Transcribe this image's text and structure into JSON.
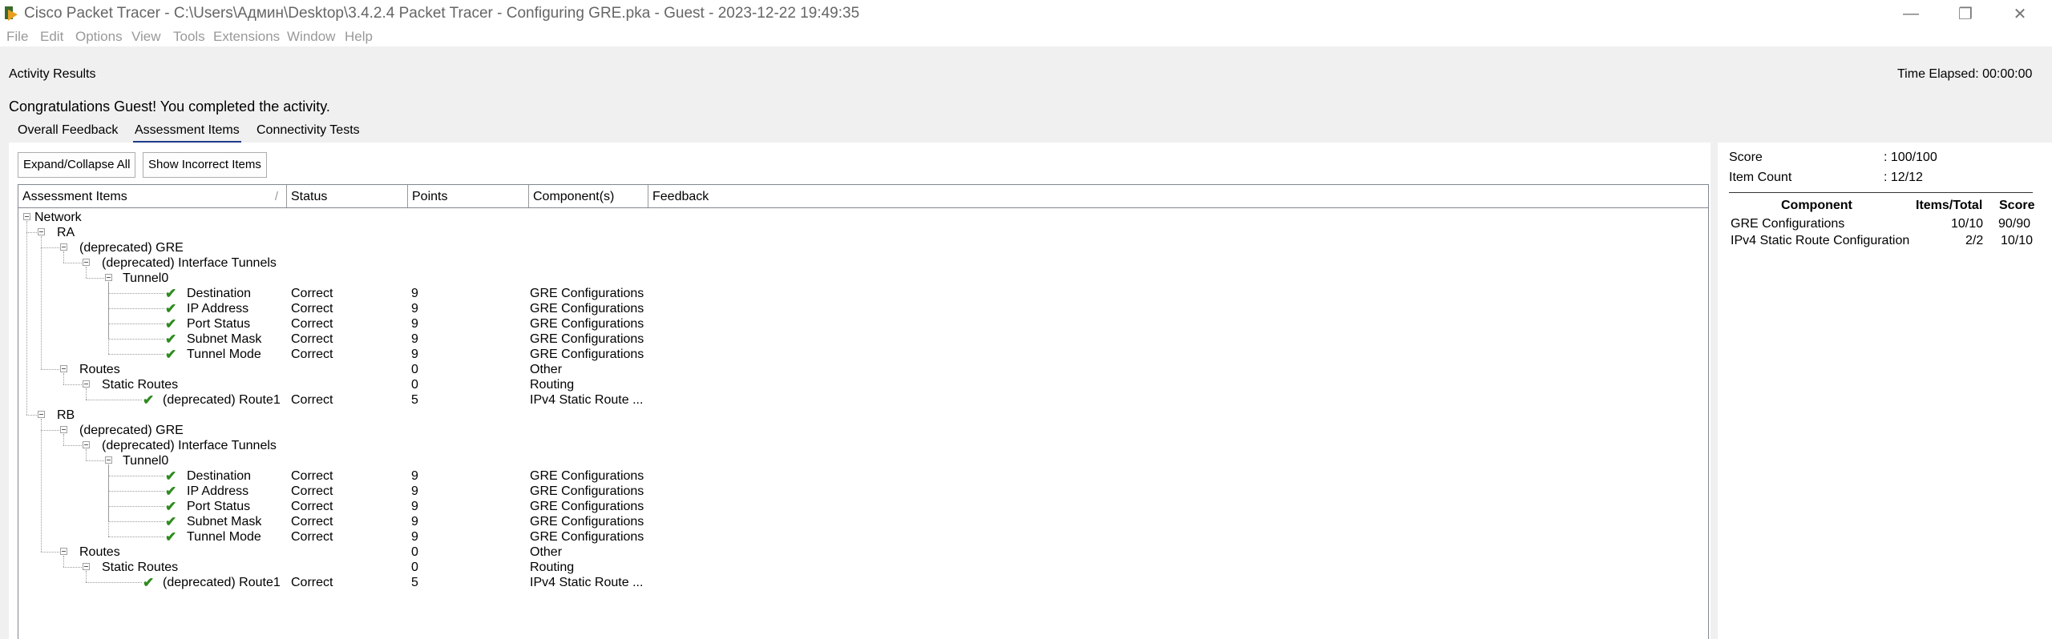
{
  "window": {
    "title": "Cisco Packet Tracer - C:\\Users\\Админ\\Desktop\\3.4.2.4 Packet Tracer - Configuring GRE.pka - Guest - 2023-12-22 19:49:35",
    "minimize": "—",
    "restore": "❐",
    "close": "✕"
  },
  "menu": [
    "File",
    "Edit",
    "Options",
    "View",
    "Tools",
    "Extensions",
    "Window",
    "Help"
  ],
  "activity": {
    "title": "Activity Results",
    "time_elapsed": "Time Elapsed: 00:00:00",
    "congrats": "Congratulations Guest! You completed the activity."
  },
  "tabs": [
    "Overall Feedback",
    "Assessment Items",
    "Connectivity Tests"
  ],
  "buttons": {
    "expand": "Expand/Collapse All",
    "show_incorrect": "Show Incorrect Items"
  },
  "columns": [
    "Assessment Items",
    "Status",
    "Points",
    "Component(s)",
    "Feedback"
  ],
  "sort_glyph": "/",
  "tree": [
    {
      "label": "Network",
      "level": 0,
      "toggle": true
    },
    {
      "label": "RA",
      "level": 1,
      "toggle": true
    },
    {
      "label": "(deprecated) GRE",
      "level": 2,
      "toggle": true
    },
    {
      "label": "(deprecated) Interface Tunnels",
      "level": 3,
      "toggle": true
    },
    {
      "label": "Tunnel0",
      "level": 4,
      "toggle": true
    },
    {
      "label": "Destination",
      "level": 5,
      "check": true,
      "status": "Correct",
      "points": "9",
      "component": "GRE Configurations"
    },
    {
      "label": "IP Address",
      "level": 5,
      "check": true,
      "status": "Correct",
      "points": "9",
      "component": "GRE Configurations"
    },
    {
      "label": "Port Status",
      "level": 5,
      "check": true,
      "status": "Correct",
      "points": "9",
      "component": "GRE Configurations"
    },
    {
      "label": "Subnet Mask",
      "level": 5,
      "check": true,
      "status": "Correct",
      "points": "9",
      "component": "GRE Configurations"
    },
    {
      "label": "Tunnel Mode",
      "level": 5,
      "check": true,
      "status": "Correct",
      "points": "9",
      "component": "GRE Configurations"
    },
    {
      "label": "Routes",
      "level": 2,
      "toggle": true,
      "points": "0",
      "component": "Other"
    },
    {
      "label": "Static Routes",
      "level": 3,
      "toggle": true,
      "points": "0",
      "component": "Routing"
    },
    {
      "label": "(deprecated) Route1",
      "level": 4,
      "check": true,
      "status": "Correct",
      "points": "5",
      "component": "IPv4 Static Route ..."
    },
    {
      "label": "RB",
      "level": 1,
      "toggle": true
    },
    {
      "label": "(deprecated) GRE",
      "level": 2,
      "toggle": true
    },
    {
      "label": "(deprecated) Interface Tunnels",
      "level": 3,
      "toggle": true
    },
    {
      "label": "Tunnel0",
      "level": 4,
      "toggle": true
    },
    {
      "label": "Destination",
      "level": 5,
      "check": true,
      "status": "Correct",
      "points": "9",
      "component": "GRE Configurations"
    },
    {
      "label": "IP Address",
      "level": 5,
      "check": true,
      "status": "Correct",
      "points": "9",
      "component": "GRE Configurations"
    },
    {
      "label": "Port Status",
      "level": 5,
      "check": true,
      "status": "Correct",
      "points": "9",
      "component": "GRE Configurations"
    },
    {
      "label": "Subnet Mask",
      "level": 5,
      "check": true,
      "status": "Correct",
      "points": "9",
      "component": "GRE Configurations"
    },
    {
      "label": "Tunnel Mode",
      "level": 5,
      "check": true,
      "status": "Correct",
      "points": "9",
      "component": "GRE Configurations"
    },
    {
      "label": "Routes",
      "level": 2,
      "toggle": true,
      "points": "0",
      "component": "Other"
    },
    {
      "label": "Static Routes",
      "level": 3,
      "toggle": true,
      "points": "0",
      "component": "Routing"
    },
    {
      "label": "(deprecated) Route1",
      "level": 4,
      "check": true,
      "status": "Correct",
      "points": "5",
      "component": "IPv4 Static Route ..."
    }
  ],
  "summary": {
    "score_label": "Score",
    "score_value": ": 100/100",
    "count_label": "Item Count",
    "count_value": ": 12/12",
    "headers": [
      "Component",
      "Items/Total",
      "Score"
    ],
    "rows": [
      {
        "component": "GRE Configurations",
        "items": "10/10",
        "score": "90/90"
      },
      {
        "component": "IPv4 Static Route Configuration",
        "items": "2/2",
        "score": "10/10"
      }
    ]
  },
  "colors": {
    "check": "#2e8b1e",
    "active_tab": "#1e3a8a"
  }
}
